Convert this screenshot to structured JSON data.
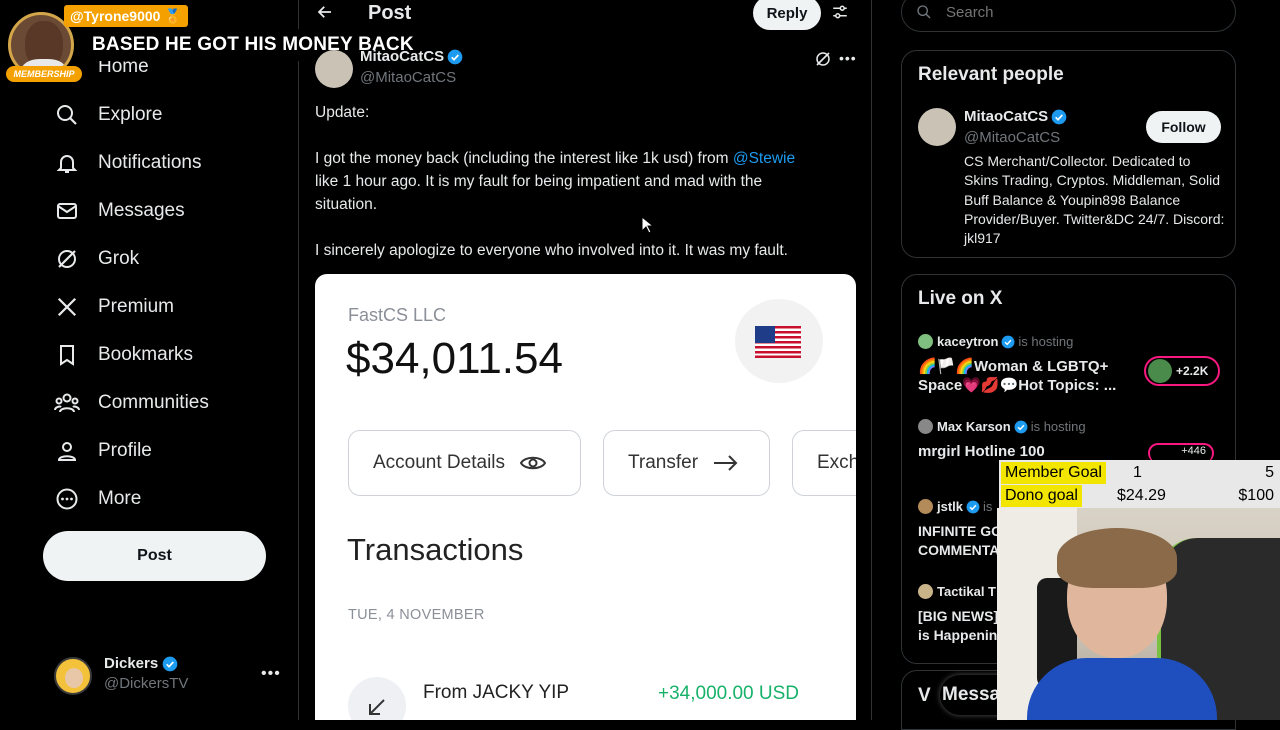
{
  "overlay": {
    "username": "@Tyrone9000",
    "message": "BASED HE GOT HIS MONEY BACK",
    "badge": "MEMBERSHIP"
  },
  "nav": {
    "items": [
      {
        "label": "Home",
        "icon": "home-icon"
      },
      {
        "label": "Explore",
        "icon": "search-icon"
      },
      {
        "label": "Notifications",
        "icon": "bell-icon"
      },
      {
        "label": "Messages",
        "icon": "mail-icon"
      },
      {
        "label": "Grok",
        "icon": "grok-icon"
      },
      {
        "label": "Premium",
        "icon": "x-logo-icon"
      },
      {
        "label": "Bookmarks",
        "icon": "bookmark-icon"
      },
      {
        "label": "Communities",
        "icon": "communities-icon"
      },
      {
        "label": "Profile",
        "icon": "profile-icon"
      },
      {
        "label": "More",
        "icon": "more-circle-icon"
      }
    ],
    "post_label": "Post",
    "account": {
      "name": "Dickers",
      "handle": "@DickersTV"
    }
  },
  "header": {
    "title": "Post",
    "reply_label": "Reply"
  },
  "tweet": {
    "author_name": "MitaoCatCS",
    "handle": "@MitaoCatCS",
    "line1": "Update:",
    "line2_a": "I got the money back (including the interest like 1k usd) from ",
    "mention": "@Stewie",
    "line2_b": "like 1 hour ago. It is my fault for being impatient and mad with the",
    "line2_c": "situation.",
    "line3": "I sincerely apologize to everyone who involved into it. It was my fault."
  },
  "bank_card": {
    "company": "FastCS LLC",
    "balance": "$34,011.54",
    "buttons": [
      "Account Details",
      "Transfer",
      "Exch"
    ],
    "section_title": "Transactions",
    "date": "TUE, 4 NOVEMBER",
    "transaction": {
      "from": "From JACKY YIP",
      "amount": "+34,000.00 USD"
    }
  },
  "search": {
    "placeholder": "Search"
  },
  "relevant": {
    "title": "Relevant people",
    "name": "MitaoCatCS",
    "handle": "@MitaoCatCS",
    "follow_label": "Follow",
    "bio": "CS Merchant/Collector. Dedicated to Skins Trading, Cryptos. Middleman, Solid Buff Balance & Youpin898 Balance Provider/Buyer. Twitter&DC 24/7. Discord: jkl917"
  },
  "live": {
    "title": "Live on X",
    "items": [
      {
        "host": "kaceytron",
        "status": "is hosting",
        "title_a": "🌈🏳️🌈Woman & LGBTQ+",
        "title_b": "Space💗💋💬Hot Topics: ...",
        "count": "+2.2K"
      },
      {
        "host": "Max Karson",
        "status": "is hosting",
        "title_a": "mrgirl Hotline 100",
        "count": "+446"
      },
      {
        "host": "jstlk",
        "status": "is",
        "title_a": "INFINITE GO",
        "title_b": "COMMENTA"
      },
      {
        "host": "Tactikal T",
        "title_a": "[BIG NEWS]",
        "title_b": "is Happenin"
      }
    ],
    "messages_label": "Messa"
  },
  "goals": {
    "member_label": "Member Goal",
    "member_current": "1",
    "member_target": "5",
    "dono_label": "Dono goal",
    "dono_current": "$24.29",
    "dono_target": "$100"
  },
  "colors": {
    "accent": "#1d9bf0",
    "green": "#17b26a",
    "goal_highlight": "#f2e600"
  }
}
